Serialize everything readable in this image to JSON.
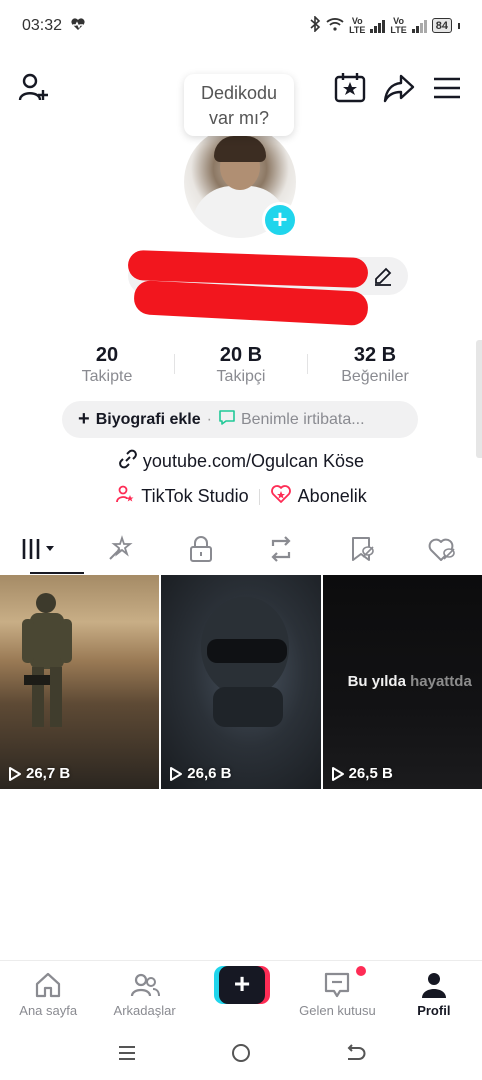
{
  "status_bar": {
    "time": "03:32",
    "network_1": "Vo\nLTE",
    "network_2": "Vo\nLTE",
    "battery": "84"
  },
  "header": {
    "tooltip_line1": "Dedikodu",
    "tooltip_line2": "var mı?",
    "icons": [
      "add-friend-icon",
      "calendar-star-icon",
      "share-icon",
      "menu-icon"
    ]
  },
  "profile": {
    "username": "",
    "stats": [
      {
        "value": "20",
        "label": "Takipte"
      },
      {
        "value": "20 B",
        "label": "Takipçi"
      },
      {
        "value": "32 B",
        "label": "Beğeniler"
      }
    ],
    "bio_add": "Biyografi ekle",
    "bio_contact": "Benimle irtibata...",
    "link": "youtube.com/Ogulcan Köse",
    "studio": "TikTok Studio",
    "subscription": "Abonelik"
  },
  "tabs": [
    "videos-grid-icon",
    "reposts-icon",
    "private-icon",
    "repost-arrows-icon",
    "saved-icon",
    "liked-icon"
  ],
  "videos": [
    {
      "views": "26,7 B"
    },
    {
      "views": "26,6 B"
    },
    {
      "views": "26,5 B",
      "overlay_main": "Bu yılda ",
      "overlay_dim": "hayattda"
    }
  ],
  "bottom_nav": [
    {
      "label": "Ana sayfa",
      "icon": "home-icon"
    },
    {
      "label": "Arkadaşlar",
      "icon": "friends-icon"
    },
    {
      "label": "",
      "icon": "create-icon"
    },
    {
      "label": "Gelen kutusu",
      "icon": "inbox-icon"
    },
    {
      "label": "Profil",
      "icon": "profile-icon"
    }
  ],
  "colors": {
    "accent_pink": "#fe2c55",
    "accent_cyan": "#20d5ec",
    "text_primary": "#161823",
    "text_secondary": "#8a8b91"
  }
}
